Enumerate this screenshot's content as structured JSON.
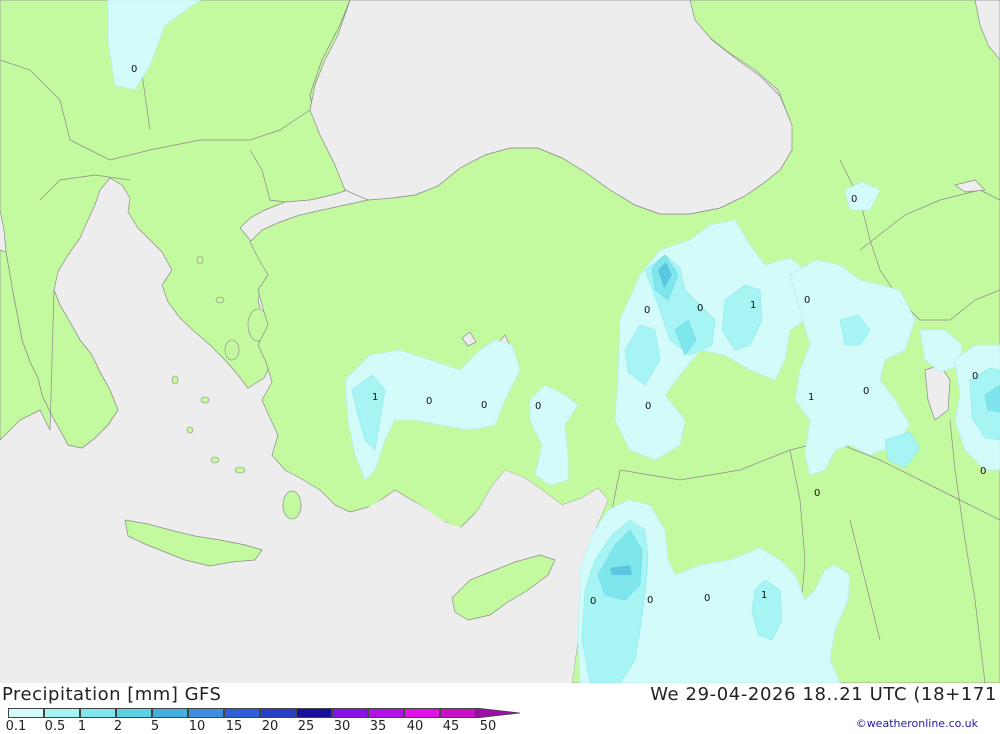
{
  "title": "Precipitation [mm] GFS",
  "run_time": "We 29-04-2026 18..21 UTC (18+171",
  "copyright": "©weatheronline.co.uk",
  "colors": {
    "sea": "#ededed",
    "land": "#c4fa9f",
    "border": "#8a8a8a",
    "precip_light": "#d2fbfa",
    "precip_mid": "#a6f5f4",
    "precip_high": "#7ee6ec",
    "precip_peak": "#5cc6e0"
  },
  "legend": {
    "labels": [
      "0.1",
      "0.5",
      "1",
      "2",
      "5",
      "10",
      "15",
      "20",
      "25",
      "30",
      "35",
      "40",
      "45",
      "50"
    ],
    "colors": [
      "#d2fbfa",
      "#a6f5f4",
      "#7ee6ec",
      "#5cd2e4",
      "#45b0e0",
      "#3c8fe0",
      "#2f5fd8",
      "#2a3fc8",
      "#18109c",
      "#8a10e8",
      "#b410e8",
      "#e010e8",
      "#c810c8",
      "#9c10a8"
    ]
  },
  "map_values": [
    "0",
    "0",
    "0",
    "1",
    "0",
    "1",
    "0",
    "0",
    "0",
    "0",
    "0",
    "1",
    "0",
    "0",
    "0",
    "0",
    "0",
    "0",
    "0",
    "1"
  ]
}
